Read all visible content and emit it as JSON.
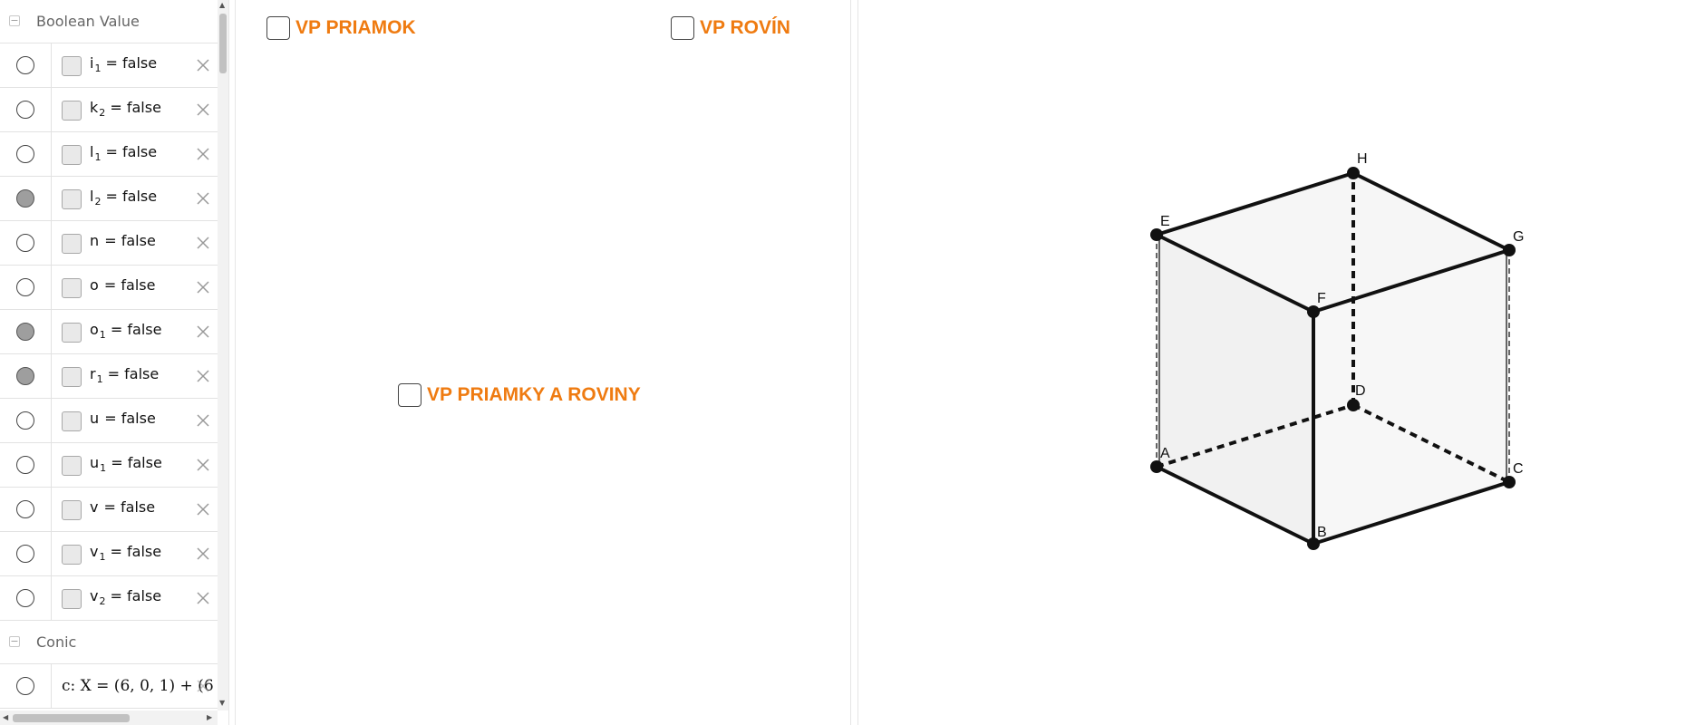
{
  "algebra": {
    "groups": {
      "boolean": {
        "label": "Boolean Value"
      },
      "conic": {
        "label": "Conic"
      }
    },
    "items": [
      {
        "name": "i",
        "sub": "1",
        "rest": " = false",
        "visible": false
      },
      {
        "name": "k",
        "sub": "2",
        "rest": " = false",
        "visible": false
      },
      {
        "name": "l",
        "sub": "1",
        "rest": " = false",
        "visible": false
      },
      {
        "name": "l",
        "sub": "2",
        "rest": " = false",
        "visible": true
      },
      {
        "name": "n",
        "sub": "",
        "rest": " = false",
        "visible": false
      },
      {
        "name": "o",
        "sub": "",
        "rest": " = false",
        "visible": false
      },
      {
        "name": "o",
        "sub": "1",
        "rest": " = false",
        "visible": true
      },
      {
        "name": "r",
        "sub": "1",
        "rest": " = false",
        "visible": true
      },
      {
        "name": "u",
        "sub": "",
        "rest": " = false",
        "visible": false
      },
      {
        "name": "u",
        "sub": "1",
        "rest": " = false",
        "visible": false
      },
      {
        "name": "v",
        "sub": "",
        "rest": " = false",
        "visible": false
      },
      {
        "name": "v",
        "sub": "1",
        "rest": " = false",
        "visible": false
      },
      {
        "name": "v",
        "sub": "2",
        "rest": " = false",
        "visible": false
      }
    ],
    "conic_item": {
      "text": "c: X = (6, 0, 1) + (6 c",
      "visible": false
    }
  },
  "graphics1": {
    "checkboxes": [
      {
        "label": "VP PRIAMOK"
      },
      {
        "label": "VP ROVÍN"
      },
      {
        "label": "VP PRIAMKY A ROVINY"
      }
    ]
  },
  "graphics2": {
    "points": [
      {
        "label": "A"
      },
      {
        "label": "B"
      },
      {
        "label": "C"
      },
      {
        "label": "D"
      },
      {
        "label": "E"
      },
      {
        "label": "F"
      },
      {
        "label": "G"
      },
      {
        "label": "H"
      }
    ]
  },
  "colors": {
    "accent": "#ef7b11",
    "visible_fill": "#9e9e9e",
    "face_fill": "#f4f4f4",
    "edge": "#111111"
  },
  "icons": {
    "delete": "close-icon",
    "collapse": "collapse-minus-icon",
    "visibility": "visibility-circle-icon"
  }
}
